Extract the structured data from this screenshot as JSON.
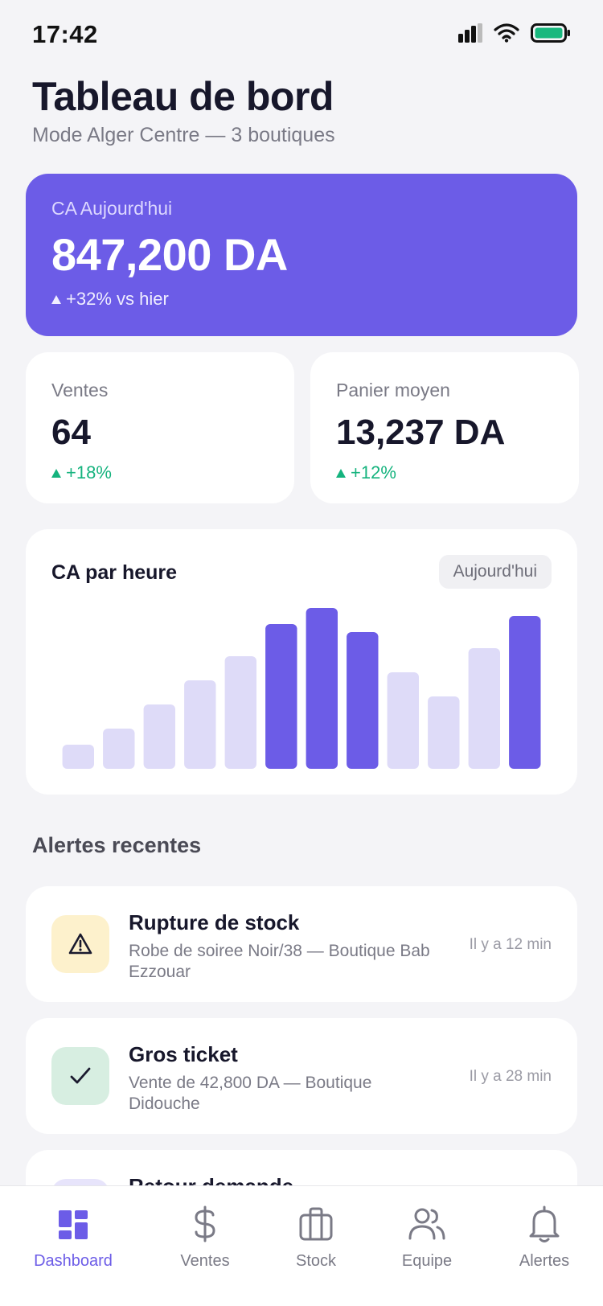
{
  "status": {
    "time": "17:42"
  },
  "header": {
    "title": "Tableau de bord",
    "subtitle": "Mode Alger Centre — 3 boutiques"
  },
  "hero": {
    "label": "CA Aujourd'hui",
    "value": "847,200 DA",
    "delta": "+32% vs hier"
  },
  "stats": [
    {
      "label": "Ventes",
      "value": "64",
      "delta": "+18%"
    },
    {
      "label": "Panier moyen",
      "value": "13,237 DA",
      "delta": "+12%"
    }
  ],
  "chart": {
    "title": "CA par heure",
    "period_label": "Aujourd'hui"
  },
  "chart_data": {
    "type": "bar",
    "title": "CA par heure",
    "categories": [
      "",
      "",
      "",
      "",
      "",
      "",
      "",
      "",
      "",
      "",
      "",
      ""
    ],
    "values": [
      15,
      25,
      40,
      55,
      70,
      90,
      100,
      85,
      60,
      45,
      75,
      95
    ],
    "highlight": [
      false,
      false,
      false,
      false,
      false,
      true,
      true,
      true,
      false,
      false,
      false,
      true
    ],
    "ylim": [
      0,
      100
    ],
    "colors": {
      "highlight": "#6c5ce7",
      "normal": "#dedbf8"
    },
    "grid": false
  },
  "alerts_section": {
    "title": "Alertes recentes"
  },
  "alerts": [
    {
      "title": "Rupture de stock",
      "desc": "Robe de soiree Noir/38 — Boutique Bab Ezzouar",
      "time": "Il y a 12 min",
      "icon": "warning-icon",
      "bg": "#fdf1cc"
    },
    {
      "title": "Gros ticket",
      "desc": "Vente de 42,800 DA — Boutique Didouche",
      "time": "Il y a 28 min",
      "icon": "check-icon",
      "bg": "#d7eee1"
    },
    {
      "title": "Retour demande",
      "desc": "",
      "time": "",
      "icon": "return-icon",
      "bg": "#e7e4fb"
    }
  ],
  "tabbar": {
    "items": [
      {
        "label": "Dashboard",
        "icon": "dashboard-icon",
        "active": true
      },
      {
        "label": "Ventes",
        "icon": "dollar-icon",
        "active": false
      },
      {
        "label": "Stock",
        "icon": "briefcase-icon",
        "active": false
      },
      {
        "label": "Equipe",
        "icon": "users-icon",
        "active": false
      },
      {
        "label": "Alertes",
        "icon": "bell-icon",
        "active": false
      }
    ]
  },
  "colors": {
    "accent": "#6c5ce7",
    "positive": "#15b37e",
    "background": "#f4f4f7"
  }
}
